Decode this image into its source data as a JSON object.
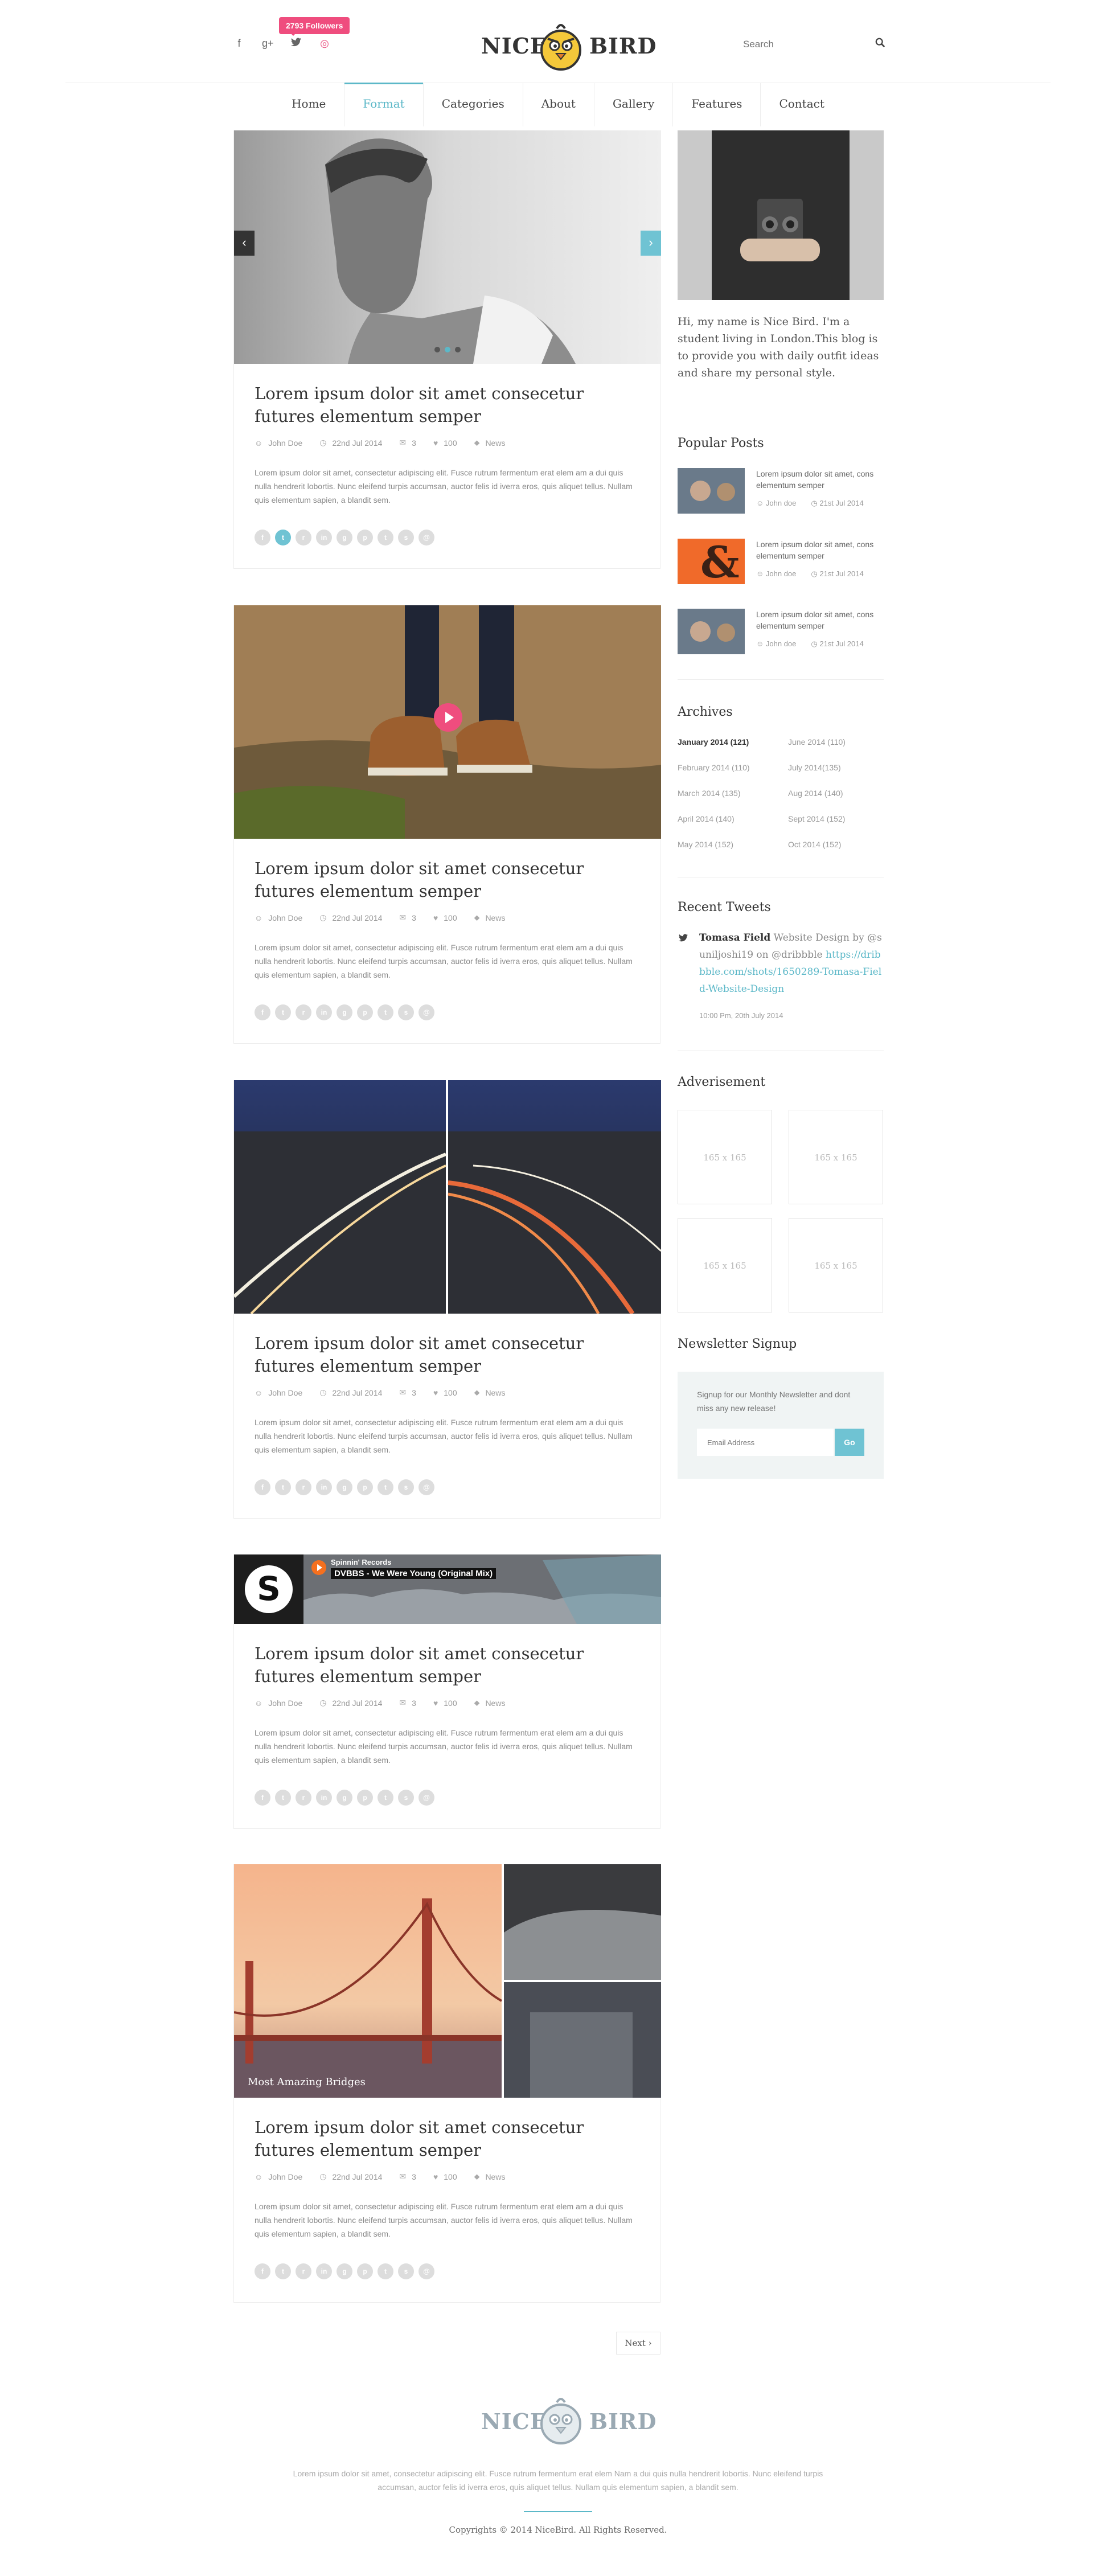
{
  "header": {
    "followers_badge": "2793 Followers",
    "social_icons": [
      "facebook-icon",
      "google-plus-icon",
      "twitter-icon",
      "dribbble-icon"
    ],
    "logo_left": "NICE",
    "logo_right": "BIRD",
    "search_placeholder": "Search"
  },
  "nav": {
    "items": [
      "Home",
      "Format",
      "Categories",
      "About",
      "Gallery",
      "Features",
      "Contact"
    ],
    "active": "Format"
  },
  "posts": [
    {
      "title": "Lorem ipsum dolor sit amet consecetur futures elementum semper",
      "author": "John Doe",
      "date": "22nd Jul 2014",
      "comments": "3",
      "likes": "100",
      "category": "News",
      "excerpt": "Lorem ipsum dolor sit amet, consectetur adipiscing elit. Fusce rutrum fermentum erat elem am a dui quis nulla hendrerit lobortis. Nunc eleifend turpis accumsan, auctor felis id iverra eros, quis aliquet tellus. Nullam quis elementum sapien, a blandit sem."
    },
    {
      "title": "Lorem ipsum dolor sit amet consecetur futures elementum semper",
      "author": "John Doe",
      "date": "22nd Jul 2014",
      "comments": "3",
      "likes": "100",
      "category": "News",
      "excerpt": "Lorem ipsum dolor sit amet, consectetur adipiscing elit. Fusce rutrum fermentum erat elem am a dui quis nulla hendrerit lobortis. Nunc eleifend turpis accumsan, auctor felis id iverra eros, quis aliquet tellus. Nullam quis elementum sapien, a blandit sem."
    },
    {
      "title": "Lorem ipsum dolor sit amet consecetur futures elementum semper",
      "author": "John Doe",
      "date": "22nd Jul 2014",
      "comments": "3",
      "likes": "100",
      "category": "News",
      "excerpt": "Lorem ipsum dolor sit amet, consectetur adipiscing elit. Fusce rutrum fermentum erat elem am a dui quis nulla hendrerit lobortis. Nunc eleifend turpis accumsan, auctor felis id iverra eros, quis aliquet tellus. Nullam quis elementum sapien, a blandit sem."
    },
    {
      "title": "Lorem ipsum dolor sit amet consecetur futures elementum semper",
      "author": "John Doe",
      "date": "22nd Jul 2014",
      "comments": "3",
      "likes": "100",
      "category": "News",
      "excerpt": "Lorem ipsum dolor sit amet, consectetur adipiscing elit. Fusce rutrum fermentum erat elem am a dui quis nulla hendrerit lobortis. Nunc eleifend turpis accumsan, auctor felis id iverra eros, quis aliquet tellus. Nullam quis elementum sapien, a blandit sem."
    },
    {
      "title": "Lorem ipsum dolor sit amet consecetur futures elementum semper",
      "author": "John Doe",
      "date": "22nd Jul 2014",
      "comments": "3",
      "likes": "100",
      "category": "News",
      "excerpt": "Lorem ipsum dolor sit amet, consectetur adipiscing elit. Fusce rutrum fermentum erat elem am a dui quis nulla hendrerit lobortis. Nunc eleifend turpis accumsan, auctor felis id iverra eros, quis aliquet tellus. Nullam quis elementum sapien, a blandit sem."
    }
  ],
  "soundcloud": {
    "label": "Spinnin' Records",
    "track": "DVBBS - We Were Young (Original Mix)"
  },
  "gallery_caption": "Most Amazing Bridges",
  "sidebar": {
    "bio": "Hi, my name is Nice Bird. I'm a student living in London.This blog is to provide you with daily outfit ideas and share my personal style.",
    "popular_title": "Popular Posts",
    "popular": [
      {
        "title": "Lorem ipsum dolor sit amet, cons elementum semper",
        "author": "John doe",
        "date": "21st Jul 2014"
      },
      {
        "title": "Lorem ipsum dolor sit amet, cons elementum semper",
        "author": "John doe",
        "date": "21st Jul 2014"
      },
      {
        "title": "Lorem ipsum dolor sit amet, cons elementum semper",
        "author": "John doe",
        "date": "21st Jul 2014"
      }
    ],
    "archives_title": "Archives",
    "archives_left": [
      "January 2014 (121)",
      "February 2014 (110)",
      "March 2014 (135)",
      "April 2014 (140)",
      "May 2014 (152)"
    ],
    "archives_right": [
      "June 2014 (110)",
      "July 2014(135)",
      "Aug 2014 (140)",
      "Sept 2014 (152)",
      "Oct 2014 (152)"
    ],
    "tweets_title": "Recent Tweets",
    "tweet_author": "Tomasa Field",
    "tweet_text_1": "Website Design by",
    "tweet_text_2": "@suniljoshi19 on @dribbble",
    "tweet_link": "https://dribbble.com/shots/1650289-Tomasa-Field-Website-Design",
    "tweet_time": "10:00 Pm, 20th July 2014",
    "ad_title": "Adverisement",
    "ads": [
      "165 x 165",
      "165 x 165",
      "165 x 165",
      "165 x 165"
    ],
    "newsletter_title": "Newsletter Signup",
    "newsletter_text": "Signup for our Monthly Newsletter and dont miss any new release!",
    "email_placeholder": "Email Address",
    "go_label": "Go"
  },
  "pagination": {
    "next": "Next"
  },
  "footer": {
    "text": "Lorem ipsum dolor sit amet, consectetur adipiscing elit. Fusce rutrum fermentum erat elem Nam a dui quis nulla hendrerit lobortis. Nunc eleifend turpis accumsan, auctor felis id iverra eros, quis aliquet tellus. Nullam quis elementum sapien, a blandit sem.",
    "copyright": "Copyrights © 2014 NiceBird. All Rights Reserved."
  },
  "colors": {
    "accent": "#5cb8c8",
    "pink": "#ef4d7e"
  }
}
